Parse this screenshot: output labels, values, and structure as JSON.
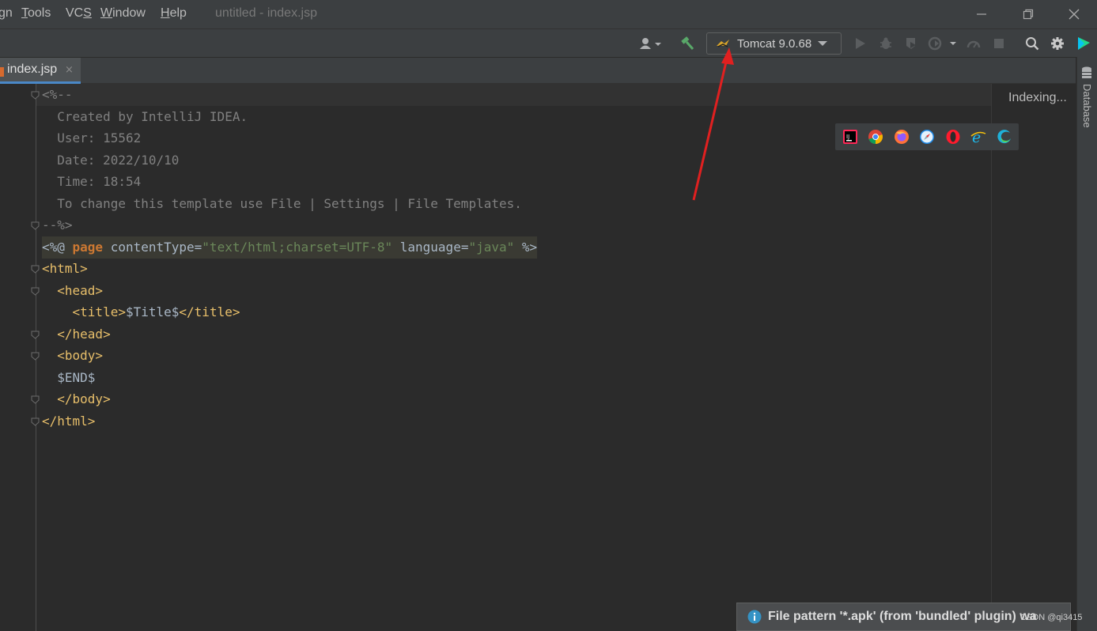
{
  "menu": {
    "items": [
      {
        "label_pre": "",
        "label_u": "",
        "label_post": "gn"
      },
      {
        "label_pre": "",
        "label_u": "T",
        "label_post": "ools"
      },
      {
        "label_pre": "VC",
        "label_u": "S",
        "label_post": ""
      },
      {
        "label_pre": "",
        "label_u": "W",
        "label_post": "indow"
      },
      {
        "label_pre": "",
        "label_u": "H",
        "label_post": "elp"
      }
    ],
    "window_title": "untitled - index.jsp"
  },
  "toolbar": {
    "run_config_label": "Tomcat 9.0.68"
  },
  "tabs": [
    {
      "label": "index.jsp",
      "close": "×"
    }
  ],
  "editor": {
    "lines": [
      {
        "parts": [
          {
            "cls": "c-comment",
            "text": "<%--"
          }
        ]
      },
      {
        "parts": [
          {
            "cls": "c-comment",
            "text": "  Created by IntelliJ IDEA."
          }
        ]
      },
      {
        "parts": [
          {
            "cls": "c-comment",
            "text": "  User: 15562"
          }
        ]
      },
      {
        "parts": [
          {
            "cls": "c-comment",
            "text": "  Date: 2022/10/10"
          }
        ]
      },
      {
        "parts": [
          {
            "cls": "c-comment",
            "text": "  Time: 18:54"
          }
        ]
      },
      {
        "parts": [
          {
            "cls": "c-comment",
            "text": "  To change this template use File | Settings | File Templates."
          }
        ]
      },
      {
        "parts": [
          {
            "cls": "c-comment",
            "text": "--%>"
          }
        ]
      },
      {
        "parts": [
          {
            "cls": "c-text",
            "text": "<%@ "
          },
          {
            "cls": "c-kw",
            "text": "page"
          },
          {
            "cls": "c-text",
            "text": " contentType="
          },
          {
            "cls": "c-str",
            "text": "\"text/html;charset=UTF-8\""
          },
          {
            "cls": "c-text",
            "text": " language="
          },
          {
            "cls": "c-str",
            "text": "\"java\""
          },
          {
            "cls": "c-text",
            "text": " %>"
          }
        ]
      },
      {
        "parts": [
          {
            "cls": "c-tag",
            "text": "<html>"
          }
        ]
      },
      {
        "parts": [
          {
            "cls": "c-tag",
            "text": "  <head>"
          }
        ]
      },
      {
        "parts": [
          {
            "cls": "c-tag",
            "text": "    <title>"
          },
          {
            "cls": "c-text",
            "text": "$Title$"
          },
          {
            "cls": "c-tag",
            "text": "</title>"
          }
        ]
      },
      {
        "parts": [
          {
            "cls": "c-tag",
            "text": "  </head>"
          }
        ]
      },
      {
        "parts": [
          {
            "cls": "c-tag",
            "text": "  <body>"
          }
        ]
      },
      {
        "parts": [
          {
            "cls": "c-text",
            "text": "  $END$"
          }
        ]
      },
      {
        "parts": [
          {
            "cls": "c-tag",
            "text": "  </body>"
          }
        ]
      },
      {
        "parts": [
          {
            "cls": "c-tag",
            "text": "</html>"
          }
        ]
      }
    ],
    "indexing_text": "Indexing..."
  },
  "browsers": [
    {
      "icon": "intellij-icon"
    },
    {
      "icon": "chrome-icon"
    },
    {
      "icon": "firefox-icon"
    },
    {
      "icon": "safari-icon"
    },
    {
      "icon": "opera-icon"
    },
    {
      "icon": "ie-icon"
    },
    {
      "icon": "edge-icon"
    }
  ],
  "right_strip": {
    "database_label": "Database"
  },
  "notification": {
    "text": "File pattern '*.apk' (from 'bundled' plugin) wa"
  },
  "watermark": "CSDN @qi3415",
  "colors": {
    "accent": "#4a88c7",
    "annotation": "#e02020"
  }
}
